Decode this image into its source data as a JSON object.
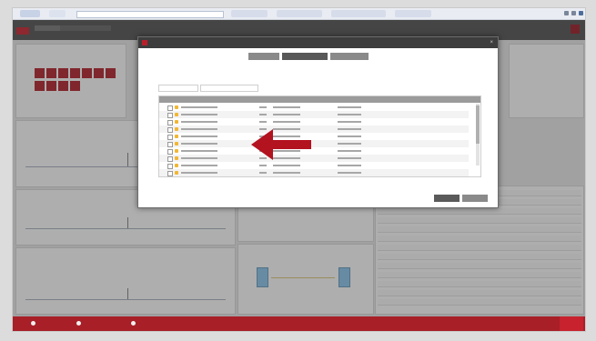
{
  "colors": {
    "brand_red": "#b81e2a",
    "status_bar": "#a81f28",
    "header_dark": "#4a4a4a",
    "annotation_arrow": "#b3121f",
    "row_icon": "#f2b632"
  },
  "annotation": {
    "icon": "left-arrow-icon",
    "points_to": "table rows"
  }
}
